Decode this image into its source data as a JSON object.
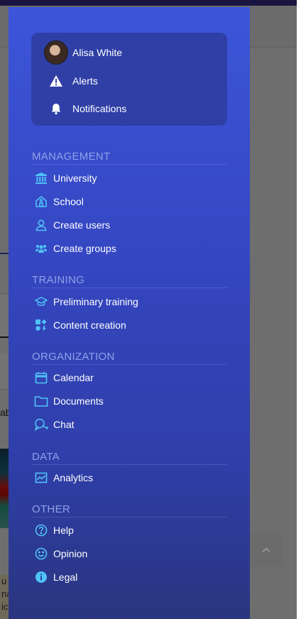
{
  "background": {
    "edge_text": "ab",
    "cream_lines": [
      "u",
      "na",
      "ic"
    ]
  },
  "user_card": {
    "user_name": "Alisa White",
    "alerts_label": "Alerts",
    "notifications_label": "Notifications"
  },
  "sections": {
    "management": {
      "title": "MANAGEMENT",
      "items": [
        {
          "label": "University",
          "icon": "university-icon"
        },
        {
          "label": "School",
          "icon": "school-icon"
        },
        {
          "label": "Create users",
          "icon": "user-icon"
        },
        {
          "label": "Create groups",
          "icon": "groups-icon"
        }
      ]
    },
    "training": {
      "title": "TRAINING",
      "items": [
        {
          "label": "Preliminary training",
          "icon": "graduation-cap-icon"
        },
        {
          "label": "Content creation",
          "icon": "content-creation-icon"
        }
      ]
    },
    "organization": {
      "title": "ORGANIZATION",
      "items": [
        {
          "label": "Calendar",
          "icon": "calendar-icon"
        },
        {
          "label": "Documents",
          "icon": "folder-icon"
        },
        {
          "label": "Chat",
          "icon": "chat-icon"
        }
      ]
    },
    "data": {
      "title": "DATA",
      "items": [
        {
          "label": "Analytics",
          "icon": "analytics-icon"
        }
      ]
    },
    "other": {
      "title": "OTHER",
      "items": [
        {
          "label": "Help",
          "icon": "help-icon"
        },
        {
          "label": "Opinion",
          "icon": "smiley-icon"
        },
        {
          "label": "Legal",
          "icon": "info-icon"
        }
      ]
    }
  },
  "colors": {
    "drawer_top": "#3c55d9",
    "drawer_bottom": "#2a357e",
    "icon_accent": "#4fc3f7",
    "section_title": "#8fa1e8"
  }
}
